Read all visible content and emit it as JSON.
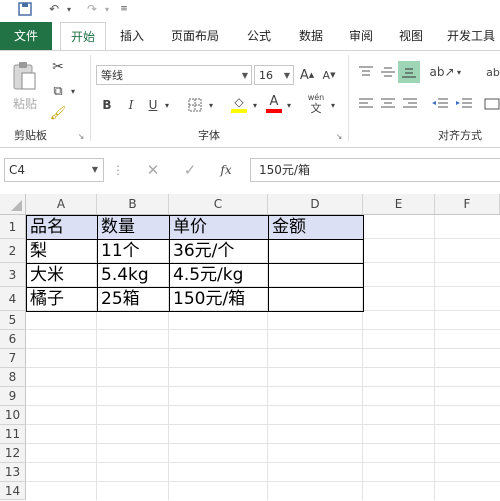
{
  "ribbon_tabs": [
    "文件",
    "开始",
    "插入",
    "页面布局",
    "公式",
    "数据",
    "审阅",
    "视图",
    "开发工具"
  ],
  "ribbon": {
    "paste_label": "粘贴",
    "clipboard_group": "剪贴板",
    "font_group": "字体",
    "align_group": "对齐方式",
    "font_name": "等线",
    "font_size": "16",
    "bold": "B",
    "italic": "I",
    "underline": "U",
    "wen": "wén",
    "wen_sub": "文"
  },
  "formula_bar": {
    "name_box": "C4",
    "fx": "fx",
    "content": "150元/箱"
  },
  "columns": [
    "A",
    "B",
    "C",
    "D",
    "E",
    "F"
  ],
  "rows": [
    "1",
    "2",
    "3",
    "4",
    "5",
    "6",
    "7",
    "8",
    "9",
    "10",
    "11",
    "12",
    "13",
    "14"
  ],
  "table": [
    [
      "品名",
      "数量",
      "单价",
      "金额"
    ],
    [
      "梨",
      "11个",
      "36元/个",
      ""
    ],
    [
      "大米",
      "5.4kg",
      "4.5元/kg",
      ""
    ],
    [
      "橘子",
      "25箱",
      "150元/箱",
      ""
    ]
  ],
  "colors": {
    "accent": "#217346",
    "header_fill": "#dce0f5",
    "highlight": "#ffff00",
    "font_color": "#ff0000"
  }
}
